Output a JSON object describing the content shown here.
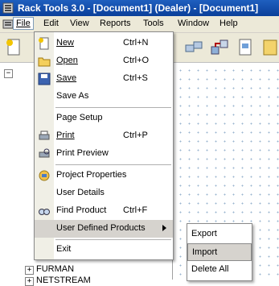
{
  "window": {
    "title": "Rack Tools 3.0 - [Document1] (Dealer) - [Document1]",
    "app_icon": "rack-tools-icon"
  },
  "menubar": [
    {
      "id": "file",
      "label": "File"
    },
    {
      "id": "edit",
      "label": "Edit"
    },
    {
      "id": "view",
      "label": "View"
    },
    {
      "id": "reports",
      "label": "Reports"
    },
    {
      "id": "tools",
      "label": "Tools"
    },
    {
      "id": "window",
      "label": "Window"
    },
    {
      "id": "help",
      "label": "Help"
    }
  ],
  "file_menu": {
    "new": {
      "label": "New",
      "shortcut": "Ctrl+N",
      "icon": "new-document-icon"
    },
    "open": {
      "label": "Open",
      "shortcut": "Ctrl+O",
      "icon": "open-folder-icon"
    },
    "save": {
      "label": "Save",
      "shortcut": "Ctrl+S",
      "icon": "save-disk-icon"
    },
    "save_as": {
      "label": "Save As"
    },
    "page_setup": {
      "label": "Page Setup"
    },
    "print": {
      "label": "Print",
      "shortcut": "Ctrl+P",
      "icon": "printer-icon"
    },
    "print_preview": {
      "label": "Print Preview",
      "icon": "print-preview-icon"
    },
    "project_properties": {
      "label": "Project Properties",
      "icon": "properties-icon"
    },
    "user_details": {
      "label": "User Details"
    },
    "find_product": {
      "label": "Find Product",
      "shortcut": "Ctrl+F",
      "icon": "find-icon"
    },
    "user_defined_products": {
      "label": "User Defined Products"
    },
    "exit": {
      "label": "Exit"
    }
  },
  "submenu": {
    "export": {
      "label": "Export"
    },
    "import": {
      "label": "Import"
    },
    "delete_all": {
      "label": "Delete All"
    }
  },
  "tree": {
    "items": [
      {
        "label": "FURMAN"
      },
      {
        "label": "NETSTREAM"
      }
    ]
  },
  "colors": {
    "title_bar": "#0a3f9a",
    "menu_highlight": "#d6d3ce",
    "menu_bar": "#ece9d8"
  }
}
